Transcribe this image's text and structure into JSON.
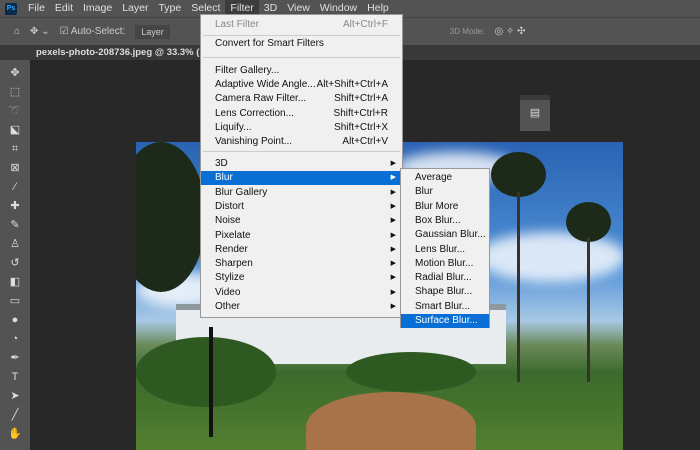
{
  "menubar": {
    "logo": "Ps",
    "items": [
      "File",
      "Edit",
      "Image",
      "Layer",
      "Type",
      "Select",
      "Filter",
      "3D",
      "View",
      "Window",
      "Help"
    ]
  },
  "options": {
    "auto_select": "Auto-Select:",
    "layer": "Layer",
    "mode_3d": "3D Mode:"
  },
  "document": {
    "tab": "pexels-photo-208736.jpeg @ 33.3% (RG"
  },
  "filter_menu": {
    "top": [
      {
        "label": "Last Filter",
        "shortcut": "Alt+Ctrl+F"
      },
      {
        "label": "Convert for Smart Filters",
        "shortcut": ""
      }
    ],
    "filters": [
      {
        "label": "Filter Gallery...",
        "shortcut": ""
      },
      {
        "label": "Adaptive Wide Angle...",
        "shortcut": "Alt+Shift+Ctrl+A"
      },
      {
        "label": "Camera Raw Filter...",
        "shortcut": "Shift+Ctrl+A"
      },
      {
        "label": "Lens Correction...",
        "shortcut": "Shift+Ctrl+R"
      },
      {
        "label": "Liquify...",
        "shortcut": "Shift+Ctrl+X"
      },
      {
        "label": "Vanishing Point...",
        "shortcut": "Alt+Ctrl+V"
      }
    ],
    "groups": [
      "3D",
      "Blur",
      "Blur Gallery",
      "Distort",
      "Noise",
      "Pixelate",
      "Render",
      "Sharpen",
      "Stylize",
      "Video",
      "Other"
    ]
  },
  "blur_submenu": [
    "Average",
    "Blur",
    "Blur More",
    "Box Blur...",
    "Gaussian Blur...",
    "Lens Blur...",
    "Motion Blur...",
    "Radial Blur...",
    "Shape Blur...",
    "Smart Blur...",
    "Surface Blur..."
  ],
  "colors": {
    "highlight": "#0a6fd4"
  }
}
